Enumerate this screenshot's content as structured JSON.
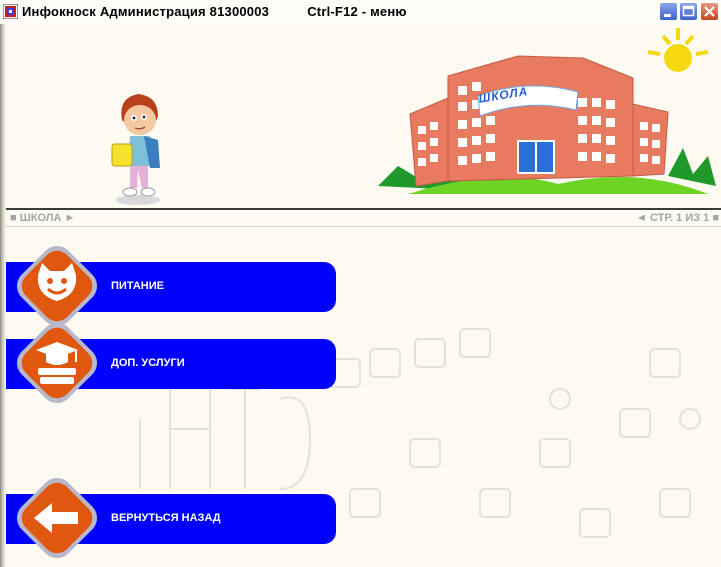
{
  "window": {
    "title": "Инфокноск Администрация 81300003          Ctrl-F12 - меню",
    "icon": "app-icon",
    "controls": [
      "minimize-icon",
      "maximize-icon",
      "close-icon"
    ]
  },
  "header": {
    "school_sign": "ШКОЛА"
  },
  "nav": {
    "breadcrumb": "■ ШКОЛА ►",
    "page_indicator": "◄ СТР. 1 ИЗ 1 ■"
  },
  "menu": [
    {
      "label": "ПИТАНИЕ",
      "icon": "smiley-face-icon"
    },
    {
      "label": "ДОП. УСЛУГИ",
      "icon": "graduation-cap-books-icon"
    },
    {
      "label": "ВЕРНУТЬСЯ НАЗАД",
      "icon": "back-arrow-icon"
    }
  ],
  "colors": {
    "button_blue": "#0000ff",
    "icon_orange": "#e0570f",
    "background": "#fcfaf1"
  }
}
